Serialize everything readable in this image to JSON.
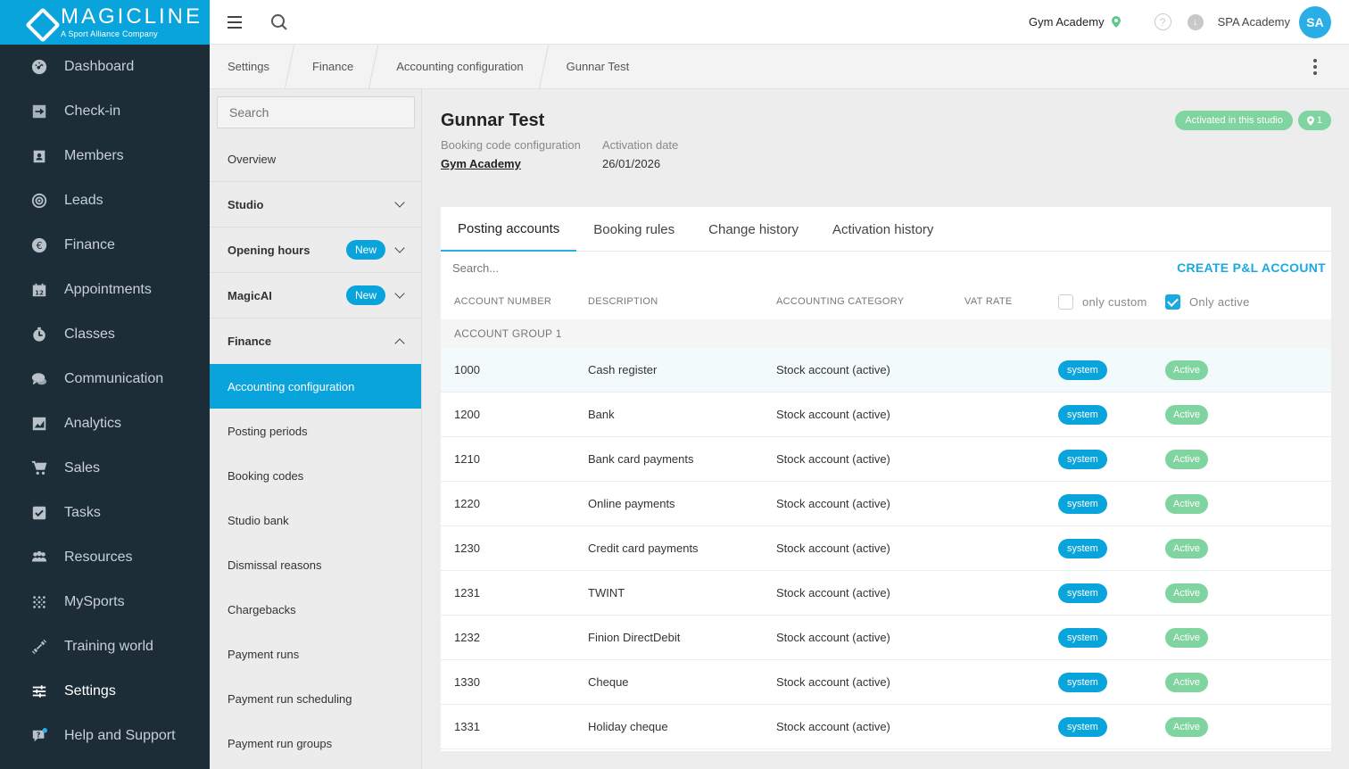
{
  "brand": {
    "name": "MAGICLINE",
    "tagline": "A Sport Alliance Company"
  },
  "leftnav": [
    {
      "label": "Dashboard",
      "icon": "dashboard-icon"
    },
    {
      "label": "Check-in",
      "icon": "check-in-icon"
    },
    {
      "label": "Members",
      "icon": "members-icon"
    },
    {
      "label": "Leads",
      "icon": "leads-icon"
    },
    {
      "label": "Finance",
      "icon": "euro-icon"
    },
    {
      "label": "Appointments",
      "icon": "calendar-icon"
    },
    {
      "label": "Classes",
      "icon": "stopwatch-icon"
    },
    {
      "label": "Communication",
      "icon": "chat-icon"
    },
    {
      "label": "Analytics",
      "icon": "chart-icon"
    },
    {
      "label": "Sales",
      "icon": "cart-icon"
    },
    {
      "label": "Tasks",
      "icon": "checkbox-icon"
    },
    {
      "label": "Resources",
      "icon": "people-icon"
    },
    {
      "label": "MySports",
      "icon": "dots-grid-icon"
    },
    {
      "label": "Training world",
      "icon": "dumbbell-icon"
    },
    {
      "label": "Settings",
      "icon": "sliders-icon",
      "active": true
    },
    {
      "label": "Help and Support",
      "icon": "help-chat-icon"
    }
  ],
  "topbar": {
    "studio": "Gym Academy",
    "account": "SPA Academy",
    "avatar": "SA",
    "help": "?",
    "download": "↓"
  },
  "breadcrumb": [
    "Settings",
    "Finance",
    "Accounting configuration",
    "Gunnar Test"
  ],
  "subnav": {
    "search_placeholder": "Search",
    "items": [
      {
        "label": "Overview"
      },
      {
        "label": "Studio"
      },
      {
        "label": "Opening hours",
        "badge": "New"
      },
      {
        "label": "MagicAI",
        "badge": "New"
      },
      {
        "label": "Finance"
      },
      {
        "label": "Accounting configuration"
      },
      {
        "label": "Posting periods"
      },
      {
        "label": "Booking codes"
      },
      {
        "label": "Studio bank"
      },
      {
        "label": "Dismissal reasons"
      },
      {
        "label": "Chargebacks"
      },
      {
        "label": "Payment runs"
      },
      {
        "label": "Payment run scheduling"
      },
      {
        "label": "Payment run groups"
      }
    ]
  },
  "detail": {
    "title": "Gunnar Test",
    "booking_label": "Booking code configuration",
    "booking_value": "Gym Academy",
    "activation_label": "Activation date",
    "activation_value": "26/01/2026",
    "status_badge": "Activated in this studio",
    "location_count": "1"
  },
  "tabs": [
    "Posting accounts",
    "Booking rules",
    "Change history",
    "Activation history"
  ],
  "table": {
    "search_placeholder": "Search...",
    "create_label": "CREATE P&L ACCOUNT",
    "headers": [
      "ACCOUNT NUMBER",
      "DESCRIPTION",
      "ACCOUNTING CATEGORY",
      "VAT RATE"
    ],
    "filter_custom": "only custom",
    "filter_active": "Only active",
    "group": "ACCOUNT GROUP 1",
    "rows": [
      {
        "number": "1000",
        "description": "Cash register",
        "category": "Stock account (active)",
        "type": "system",
        "status": "Active"
      },
      {
        "number": "1200",
        "description": "Bank",
        "category": "Stock account (active)",
        "type": "system",
        "status": "Active"
      },
      {
        "number": "1210",
        "description": "Bank card payments",
        "category": "Stock account (active)",
        "type": "system",
        "status": "Active"
      },
      {
        "number": "1220",
        "description": "Online payments",
        "category": "Stock account (active)",
        "type": "system",
        "status": "Active"
      },
      {
        "number": "1230",
        "description": "Credit card payments",
        "category": "Stock account (active)",
        "type": "system",
        "status": "Active"
      },
      {
        "number": "1231",
        "description": "TWINT",
        "category": "Stock account (active)",
        "type": "system",
        "status": "Active"
      },
      {
        "number": "1232",
        "description": "Finion DirectDebit",
        "category": "Stock account (active)",
        "type": "system",
        "status": "Active"
      },
      {
        "number": "1330",
        "description": "Cheque",
        "category": "Stock account (active)",
        "type": "system",
        "status": "Active"
      },
      {
        "number": "1331",
        "description": "Holiday cheque",
        "category": "Stock account (active)",
        "type": "system",
        "status": "Active"
      }
    ]
  },
  "colors": {
    "brand": "#0aa4dc",
    "nav_bg": "#1d2d38",
    "active_green": "#7fd4a0"
  }
}
